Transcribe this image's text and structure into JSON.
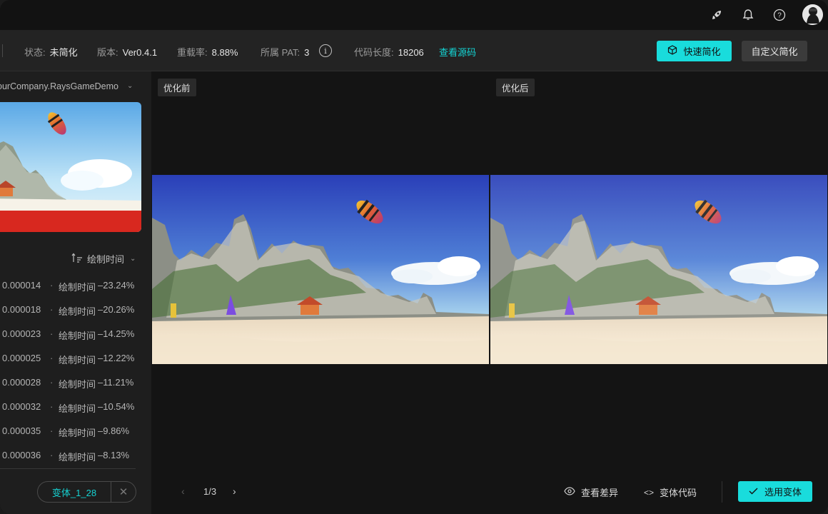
{
  "toolbar": {
    "status_label": "状态:",
    "status_value": "未简化",
    "version_label": "版本:",
    "version_value": "Ver0.4.1",
    "reload_label": "重载率:",
    "reload_value": "8.88%",
    "pat_label": "所属 PAT:",
    "pat_value": "3",
    "code_len_label": "代码长度:",
    "code_len_value": "18206",
    "view_source": "查看源码",
    "quick_simplify": "快速简化",
    "custom_simplify": "自定义简化"
  },
  "left": {
    "project": "ourCompany.RaysGameDemo",
    "sort_label": "绘制时间",
    "variants": [
      {
        "value": "0.000014",
        "label": "绘制时间",
        "pct": "–23.24%"
      },
      {
        "value": "0.000018",
        "label": "绘制时间",
        "pct": "–20.26%"
      },
      {
        "value": "0.000023",
        "label": "绘制时间",
        "pct": "–14.25%"
      },
      {
        "value": "0.000025",
        "label": "绘制时间",
        "pct": "–12.22%"
      },
      {
        "value": "0.000028",
        "label": "绘制时间",
        "pct": "–11.21%"
      },
      {
        "value": "0.000032",
        "label": "绘制时间",
        "pct": "–10.54%"
      },
      {
        "value": "0.000035",
        "label": "绘制时间",
        "pct": "–9.86%"
      },
      {
        "value": "0.000036",
        "label": "绘制时间",
        "pct": "–8.13%"
      }
    ],
    "chip_label": "变体_1_28"
  },
  "main": {
    "before_label": "优化前",
    "after_label": "优化后",
    "pager": "1/3",
    "view_diff": "查看差异",
    "variant_code": "变体代码",
    "apply_variant": "选用变体"
  },
  "colors": {
    "accent": "#19dcdc",
    "background": "#141414",
    "panel": "#1e1e1e"
  },
  "icons": [
    "rocket-icon",
    "bell-icon",
    "help-icon",
    "info-icon",
    "cube-icon",
    "sort-icon",
    "close-icon",
    "eye-icon",
    "code-icon",
    "check-icon"
  ]
}
